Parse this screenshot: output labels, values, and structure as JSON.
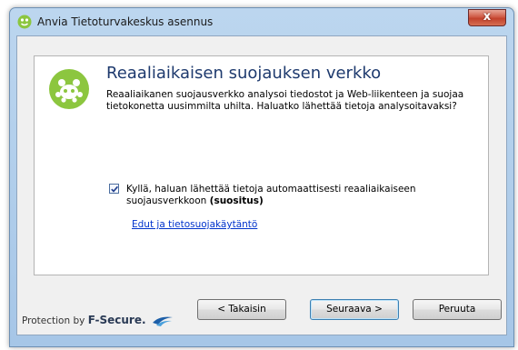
{
  "window": {
    "title": "Anvia Tietoturvakeskus asennus",
    "close_label": "x"
  },
  "content": {
    "heading": "Reaaliaikaisen suojauksen verkko",
    "description": "Reaaliaikanen suojausverkko analysoi tiedostot ja Web-liikenteen ja suojaa tietokonetta uusimmilta uhilta. Haluatko lähettää tietoja analysoitavaksi?",
    "consent_text": "Kyllä, haluan lähettää tietoja automaattisesti reaaliaikaiseen suojausverkkoon",
    "consent_recommended": "(suositus)",
    "consent_checked": true,
    "privacy_link": "Edut ja tietosuojakäytäntö"
  },
  "footer": {
    "protection_by": "Protection by",
    "brand": "F-Secure.",
    "back_label": "< Takaisin",
    "next_label": "Seuraava >",
    "cancel_label": "Peruuta"
  },
  "colors": {
    "logo_green": "#8cc63f",
    "heading_blue": "#1e3a6e",
    "link_blue": "#0033cc"
  }
}
